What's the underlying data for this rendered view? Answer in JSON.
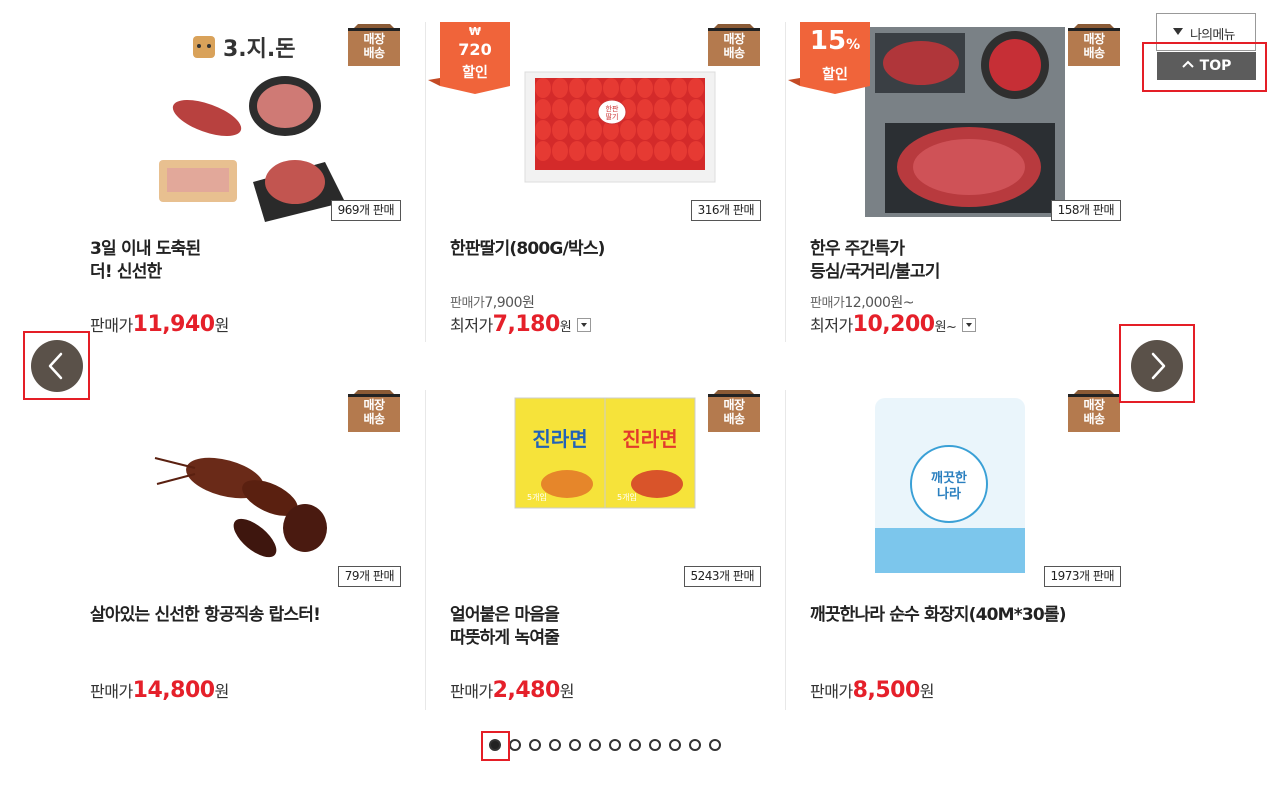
{
  "ui": {
    "store_badge": [
      "매장",
      "배송"
    ],
    "my_menu_label": "나의메뉴",
    "top_label": "TOP",
    "sale_price_label": "판매가",
    "lowest_price_label": "최저가",
    "won": "원",
    "won_from": "원~"
  },
  "products": [
    {
      "title_lines": [
        "3일 이내 도축된",
        "더! 신선한"
      ],
      "sold": "969개 판매",
      "price": "11,940",
      "brand_logo": "3.지.돈",
      "image": "pork-cuts-image"
    },
    {
      "title_lines": [
        "한판딸기(800G/박스)",
        ""
      ],
      "sold": "316개 판매",
      "regular_label": "판매가",
      "regular_value": "7,900원",
      "price": "7,180",
      "discount": {
        "top": "₩",
        "mid": "720",
        "bottom": "할인"
      },
      "image": "strawberry-box-image",
      "box_label": [
        "한판",
        "딸기"
      ]
    },
    {
      "title_lines": [
        "한우 주간특가",
        "등심/국거리/불고기"
      ],
      "sold": "158개 판매",
      "regular_label": "판매가",
      "regular_value": "12,000원~",
      "price": "10,200",
      "discount": {
        "mid": "15",
        "pct": "%",
        "bottom": "할인"
      },
      "image": "hanwoo-beef-image"
    },
    {
      "title_lines": [
        "살아있는 신선한 항공직송 랍스터!",
        ""
      ],
      "sold": "79개 판매",
      "price": "14,800",
      "image": "lobster-image"
    },
    {
      "title_lines": [
        "얼어붙은 마음을",
        "따뜻하게 녹여줄"
      ],
      "sold": "5243개 판매",
      "price": "2,480",
      "image": "jin-ramen-image",
      "pack_text": "진라면",
      "pack_count": "5개입"
    },
    {
      "title_lines": [
        "깨끗한나라 순수 화장지(40M*30롤)",
        ""
      ],
      "sold": "1973개 판매",
      "price": "8,500",
      "image": "toilet-paper-image",
      "pack_label": [
        "깨끗한",
        "나라"
      ]
    }
  ],
  "pagination": {
    "total": 12,
    "active": 0
  },
  "colors": {
    "price_red": "#e5202a",
    "badge_brown": "#b47a4e",
    "discount_orange": "#f0643a",
    "arrow_bg": "#5a5149",
    "highlight_red": "#e41e26"
  }
}
